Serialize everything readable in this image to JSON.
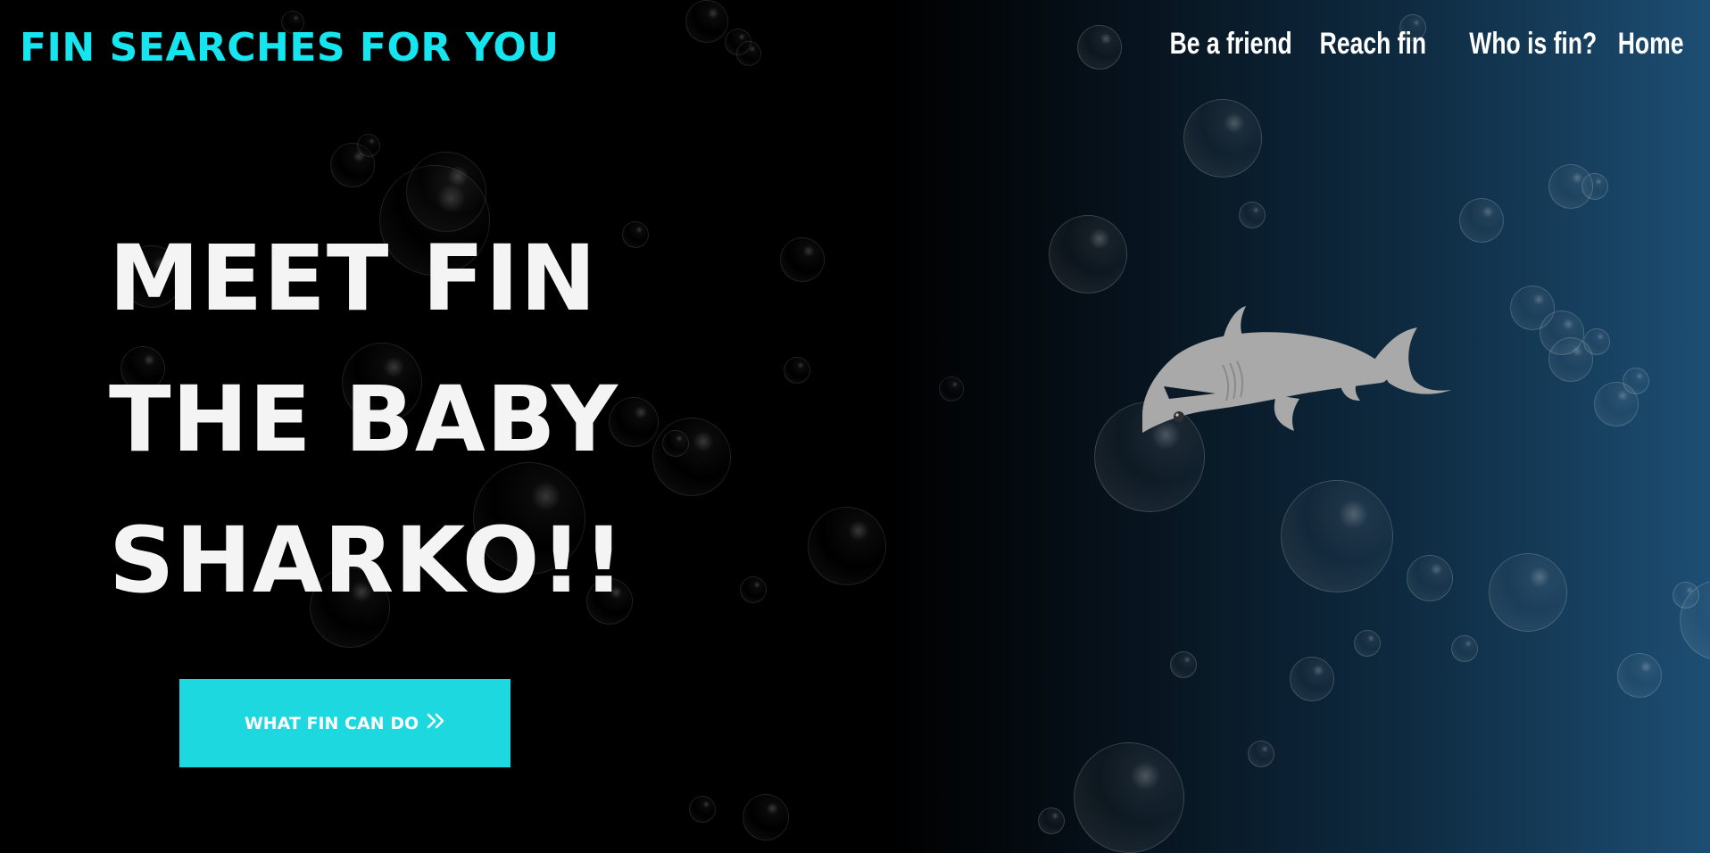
{
  "brand": {
    "name": "FIN SEARCHES FOR YOU",
    "accent_color": "#14e5ee"
  },
  "nav": {
    "items": [
      {
        "label": "Be a friend"
      },
      {
        "label": "Reach fin"
      },
      {
        "label": "Who is fin?"
      },
      {
        "label": "Home"
      }
    ]
  },
  "hero": {
    "lines": [
      "MEET FIN",
      "THE BABY",
      "SHARKO!!"
    ],
    "cta_label": "WHAT FIN CAN DO",
    "cta_icon": "double-chevron-right-icon",
    "cta_color": "#1ed8e0"
  },
  "illustration": {
    "subject": "shark-icon",
    "color": "#a9a9a9"
  }
}
